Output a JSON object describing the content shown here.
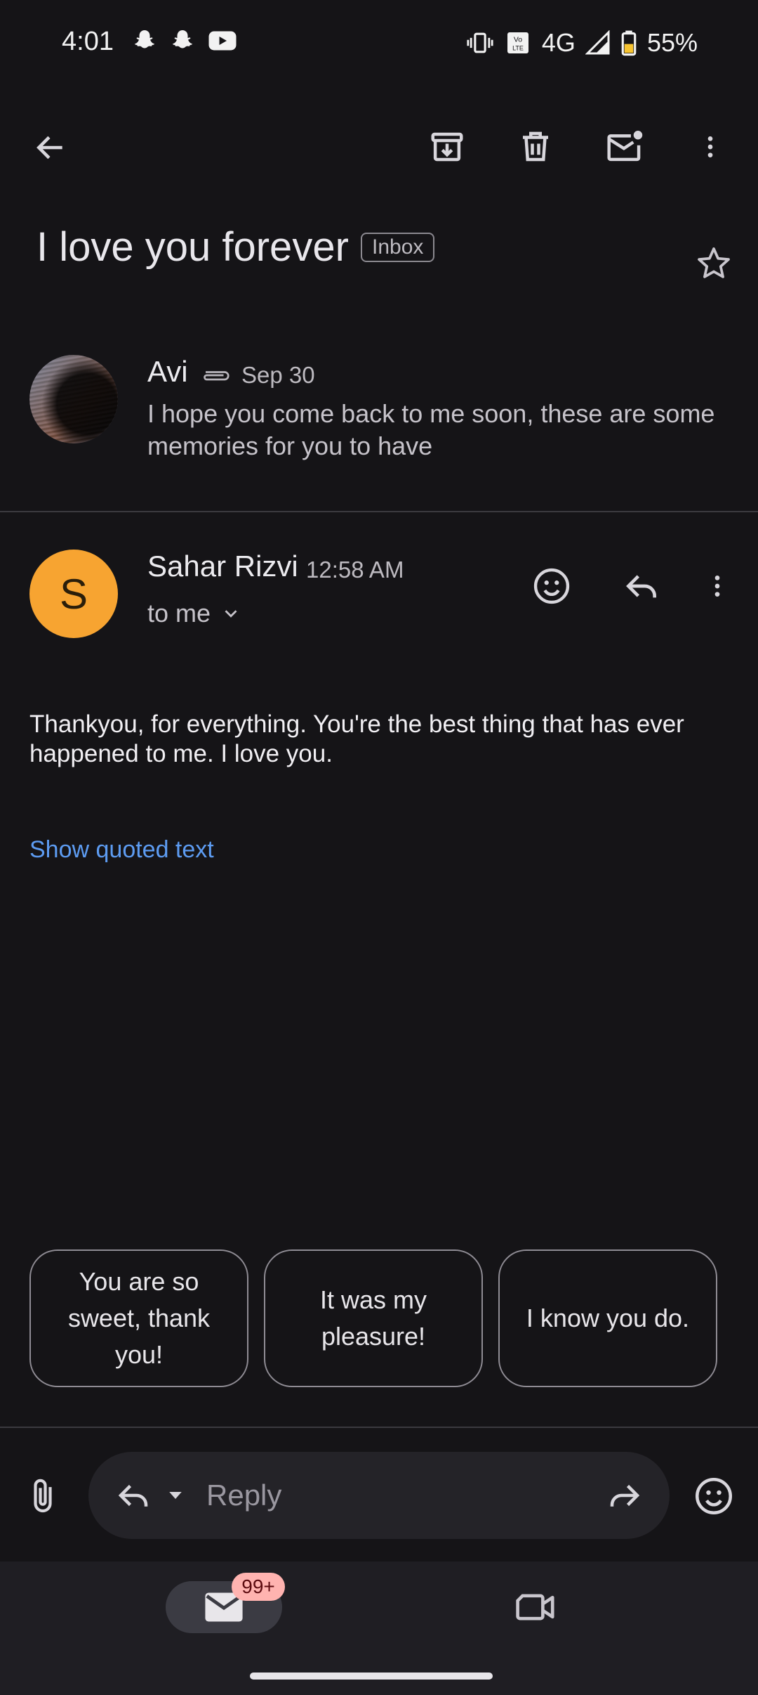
{
  "status_bar": {
    "time": "4:01",
    "network": "4G",
    "volte": "Vo LTE",
    "battery": "55%",
    "notification_icons": [
      "snapchat-icon",
      "snapchat-icon",
      "youtube-icon"
    ]
  },
  "toolbar": {
    "icons": [
      "back-arrow-icon",
      "archive-icon",
      "delete-icon",
      "mark-unread-icon",
      "more-vert-icon"
    ]
  },
  "subject": {
    "title": "I love you forever",
    "label": "Inbox"
  },
  "thread": [
    {
      "sender": "Avi",
      "date": "Sep 30",
      "snippet": "I hope you come back to me soon, these are some memories for you to have",
      "has_attachment": true
    },
    {
      "sender": "Sahar Rizvi",
      "avatar_letter": "S",
      "time": "12:58 AM",
      "recipient": "to me",
      "body": "Thankyou, for everything. You're the best thing that has ever happened to me. I love you.",
      "show_quoted": "Show quoted text"
    }
  ],
  "smart_replies": [
    "You are so sweet, thank you!",
    "It was my pleasure!",
    "I know you do."
  ],
  "compose": {
    "placeholder": "Reply"
  },
  "bottom_nav": {
    "mail_badge": "99+"
  },
  "colors": {
    "background": "#151417",
    "avatar_s": "#f7a431",
    "link": "#5d9cf2",
    "badge": "#ffb3b0"
  }
}
